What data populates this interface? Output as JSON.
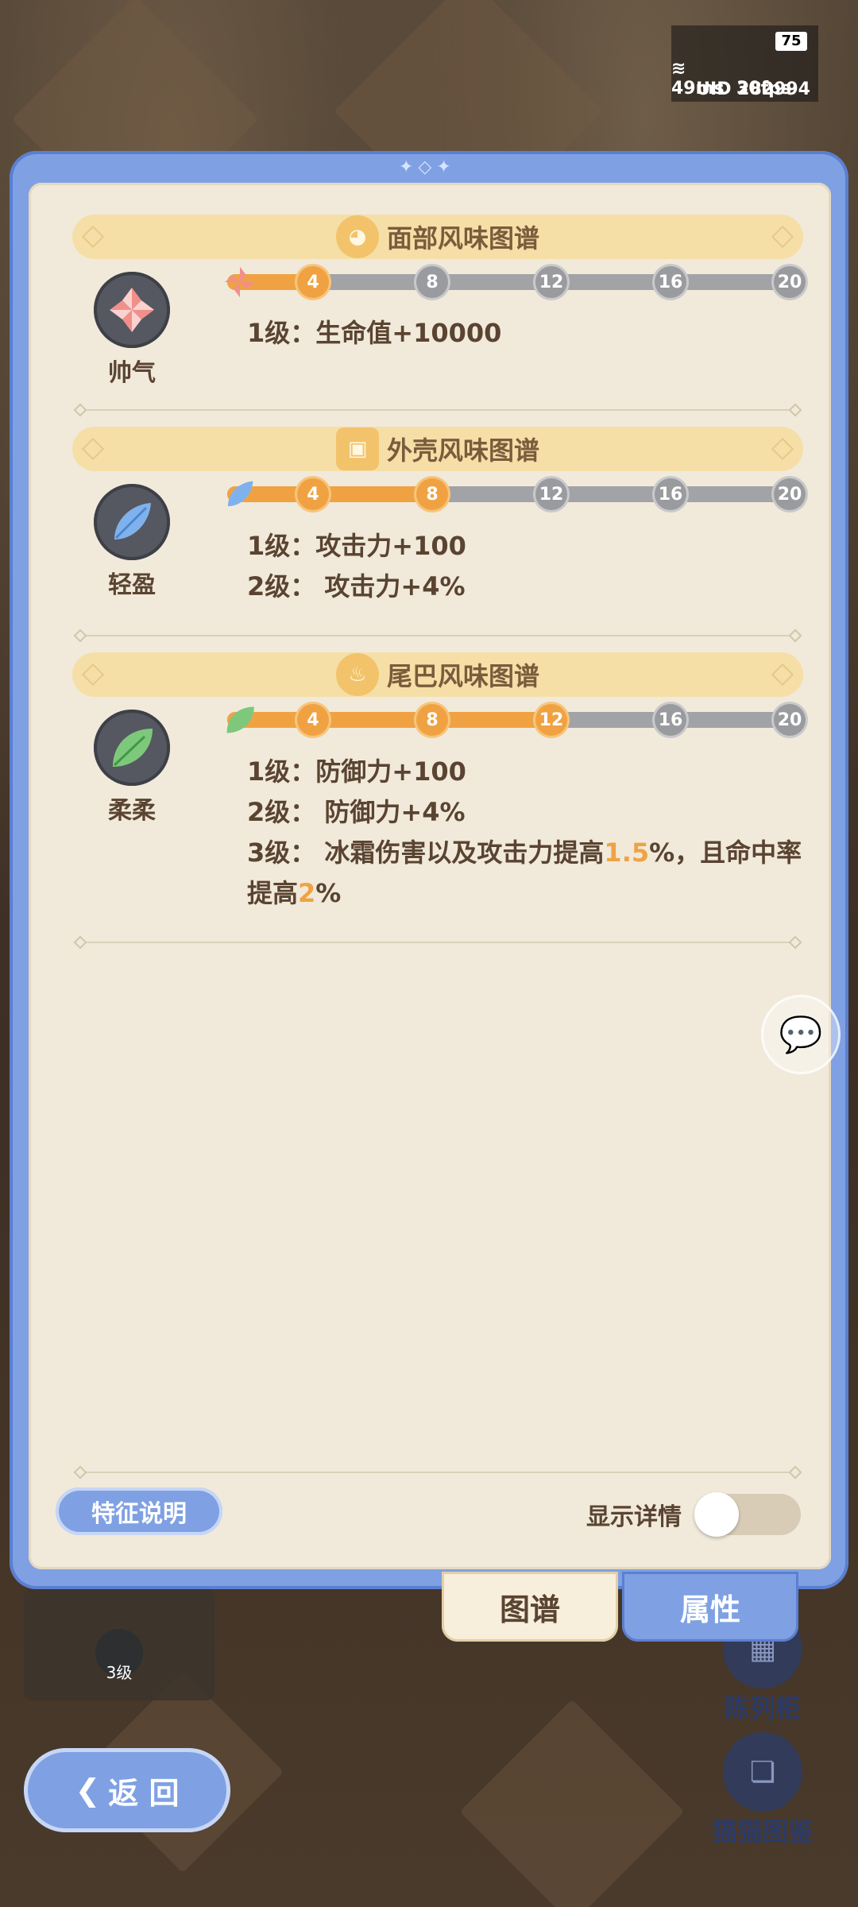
{
  "status": {
    "battery": "75",
    "ping": "49ms",
    "fps": "30fps",
    "uid": "UID 282994"
  },
  "sections": [
    {
      "title": "面部风味图谱",
      "trait": "帅气",
      "progress_level": 4,
      "nodes": [
        "4",
        "8",
        "12",
        "16",
        "20"
      ],
      "lines": [
        {
          "text": "1级：生命值+10000"
        }
      ]
    },
    {
      "title": "外壳风味图谱",
      "trait": "轻盈",
      "progress_level": 8,
      "nodes": [
        "4",
        "8",
        "12",
        "16",
        "20"
      ],
      "lines": [
        {
          "text": "1级：攻击力+100"
        },
        {
          "text": "2级： 攻击力+4%"
        }
      ]
    },
    {
      "title": "尾巴风味图谱",
      "trait": "柔柔",
      "progress_level": 12,
      "nodes": [
        "4",
        "8",
        "12",
        "16",
        "20"
      ],
      "lines": [
        {
          "text": "1级：防御力+100"
        },
        {
          "text": "2级： 防御力+4%"
        },
        {
          "pre": "3级： 冰霜伤害以及攻击力提高",
          "hl1": "1.5",
          "mid": "%，且命中率",
          "line2pre": "提高",
          "hl2": "2",
          "post": "%"
        }
      ]
    }
  ],
  "footer": {
    "feature_button": "特征说明",
    "show_details_label": "显示详情"
  },
  "tabs": {
    "atlas": "图谱",
    "attributes": "属性"
  },
  "background": {
    "display_cabinet": "陈列柜",
    "cat_gallery": "猫猫图鉴",
    "level_badge": "3级",
    "back_button": "返 回"
  },
  "colors": {
    "accent_blue": "#7fa1e3",
    "progress_orange": "#f0a243",
    "panel_bg": "#f1eadb",
    "header_bg": "#f5dfa6"
  }
}
